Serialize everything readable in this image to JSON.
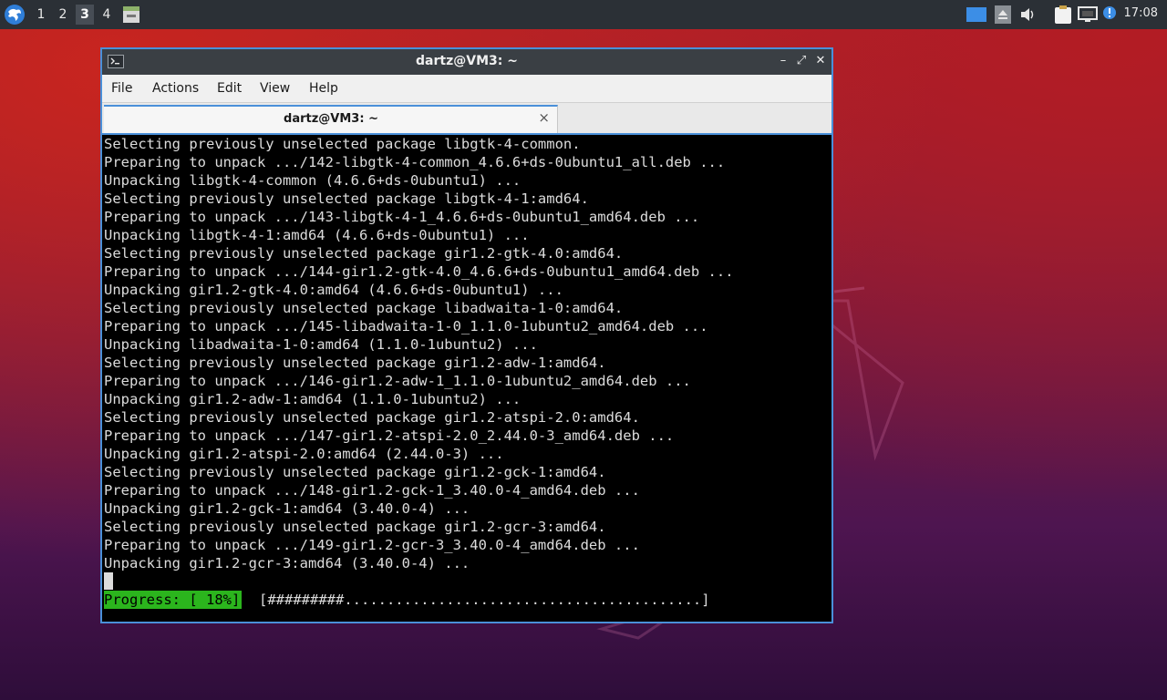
{
  "panel": {
    "workspaces": [
      "1",
      "2",
      "3",
      "4"
    ],
    "active_workspace": "3",
    "clock": "17:08",
    "icons": [
      "whisker-menu-icon",
      "window-button-icon",
      "display-icon",
      "eject-icon",
      "volume-icon",
      "clipboard-icon",
      "network-icon",
      "notification-icon"
    ]
  },
  "window": {
    "title": "dartz@VM3: ~",
    "controls": {
      "minimize": "–",
      "maximize": "⤢",
      "close": "✕"
    }
  },
  "menu": {
    "file": "File",
    "actions": "Actions",
    "edit": "Edit",
    "view": "View",
    "help": "Help"
  },
  "tab": {
    "label": "dartz@VM3: ~",
    "close": "×"
  },
  "terminal": {
    "lines": [
      "Selecting previously unselected package libgtk-4-common.",
      "Preparing to unpack .../142-libgtk-4-common_4.6.6+ds-0ubuntu1_all.deb ...",
      "Unpacking libgtk-4-common (4.6.6+ds-0ubuntu1) ...",
      "Selecting previously unselected package libgtk-4-1:amd64.",
      "Preparing to unpack .../143-libgtk-4-1_4.6.6+ds-0ubuntu1_amd64.deb ...",
      "Unpacking libgtk-4-1:amd64 (4.6.6+ds-0ubuntu1) ...",
      "Selecting previously unselected package gir1.2-gtk-4.0:amd64.",
      "Preparing to unpack .../144-gir1.2-gtk-4.0_4.6.6+ds-0ubuntu1_amd64.deb ...",
      "Unpacking gir1.2-gtk-4.0:amd64 (4.6.6+ds-0ubuntu1) ...",
      "Selecting previously unselected package libadwaita-1-0:amd64.",
      "Preparing to unpack .../145-libadwaita-1-0_1.1.0-1ubuntu2_amd64.deb ...",
      "Unpacking libadwaita-1-0:amd64 (1.1.0-1ubuntu2) ...",
      "Selecting previously unselected package gir1.2-adw-1:amd64.",
      "Preparing to unpack .../146-gir1.2-adw-1_1.1.0-1ubuntu2_amd64.deb ...",
      "Unpacking gir1.2-adw-1:amd64 (1.1.0-1ubuntu2) ...",
      "Selecting previously unselected package gir1.2-atspi-2.0:amd64.",
      "Preparing to unpack .../147-gir1.2-atspi-2.0_2.44.0-3_amd64.deb ...",
      "Unpacking gir1.2-atspi-2.0:amd64 (2.44.0-3) ...",
      "Selecting previously unselected package gir1.2-gck-1:amd64.",
      "Preparing to unpack .../148-gir1.2-gck-1_3.40.0-4_amd64.deb ...",
      "Unpacking gir1.2-gck-1:amd64 (3.40.0-4) ...",
      "Selecting previously unselected package gir1.2-gcr-3:amd64.",
      "Preparing to unpack .../149-gir1.2-gcr-3_3.40.0-4_amd64.deb ...",
      "Unpacking gir1.2-gcr-3:amd64 (3.40.0-4) ..."
    ],
    "progress_label": "Progress: [ 18%]",
    "progress_bar": "[#########..........................................]",
    "progress_percent": 18
  },
  "colors": {
    "panel_bg": "#2b3036",
    "window_border": "#4a90d9",
    "progress_green": "#2bb51d",
    "terminal_bg": "#000000",
    "terminal_fg": "#dcdcdc"
  }
}
